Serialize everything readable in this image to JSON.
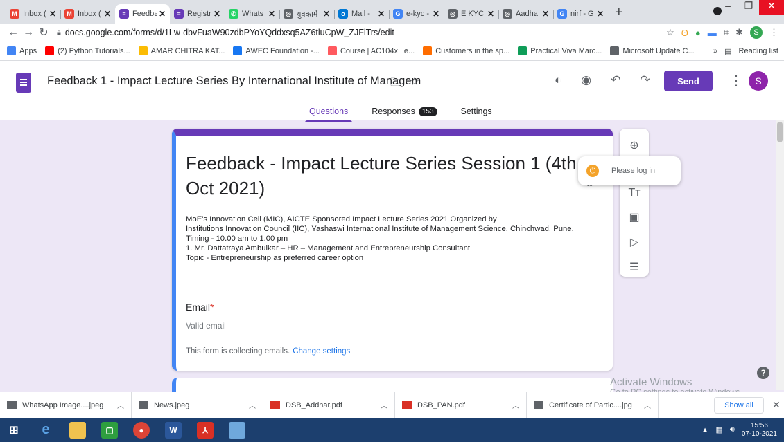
{
  "browser": {
    "tabs": [
      {
        "label": "Inbox (",
        "color": "#ea4335",
        "glyph": "M"
      },
      {
        "label": "Inbox (",
        "color": "#ea4335",
        "glyph": "M"
      },
      {
        "label": "Feedba",
        "color": "#673ab7",
        "glyph": "≡",
        "active": true
      },
      {
        "label": "Registr",
        "color": "#673ab7",
        "glyph": "≡"
      },
      {
        "label": "Whats",
        "color": "#25d366",
        "glyph": "✆"
      },
      {
        "label": "युवकार्म",
        "color": "#5f6368",
        "glyph": "◎"
      },
      {
        "label": "Mail - ",
        "color": "#0078d4",
        "glyph": "o"
      },
      {
        "label": "e-kyc -",
        "color": "#4285f4",
        "glyph": "G"
      },
      {
        "label": "E KYC (",
        "color": "#5f6368",
        "glyph": "◎"
      },
      {
        "label": "Aadha",
        "color": "#5f6368",
        "glyph": "◎"
      },
      {
        "label": "nirf - G",
        "color": "#4285f4",
        "glyph": "G"
      }
    ],
    "new_tab": "+",
    "url": "docs.google.com/forms/d/1Lw-dbvFuaW90zdbPYoYQddxsq5AZ6tluCpW_ZJFlTrs/edit",
    "profile_initial": "S",
    "bookmarks": [
      {
        "label": "Apps",
        "color": "#4285f4"
      },
      {
        "label": "(2) Python Tutorials...",
        "color": "#ff0000"
      },
      {
        "label": "AMAR CHITRA KAT...",
        "color": "#fbbc04"
      },
      {
        "label": "AWEC Foundation -...",
        "color": "#1877f2"
      },
      {
        "label": "Course | AC104x | e...",
        "color": "#ff5a5f"
      },
      {
        "label": "Customers in the sp...",
        "color": "#ff6d00"
      },
      {
        "label": "Practical Viva Marc...",
        "color": "#0f9d58"
      },
      {
        "label": "Microsoft Update C...",
        "color": "#5f6368"
      }
    ],
    "bookmarks_more": "»",
    "reading_list": "Reading list"
  },
  "form": {
    "doc_title": "Feedback 1 - Impact Lecture Series By International Institute of Managem",
    "send_label": "Send",
    "user_initial": "S",
    "tabs": {
      "questions": "Questions",
      "responses": "Responses",
      "responses_count": "153",
      "settings": "Settings"
    },
    "card": {
      "title": "Feedback - Impact Lecture Series Session 1 (4th Oct 2021)",
      "description": [
        "MoE's Innovation Cell (MIC), AICTE Sponsored Impact Lecture Series 2021 Organized by",
        "Institutions Innovation Council (IIC), Yashaswi International Institute of Management Science, Chinchwad, Pune.",
        "Timing - 10.00 am to 1.00 pm",
        "1.   Mr. Dattatraya Ambulkar – HR – Management and Entrepreneurship Consultant",
        "Topic - Entrepreneurship as preferred career option"
      ],
      "email_label": "Email",
      "required_mark": "*",
      "email_placeholder": "Valid email",
      "collecting_text": "This form is collecting emails.",
      "change_settings": "Change settings"
    },
    "popup_text": "Please log in",
    "grammarly_mark": "ω"
  },
  "overlay": {
    "activate_title": "Activate Windows",
    "activate_sub": "Go to PC settings to activate Windows."
  },
  "downloads": {
    "items": [
      {
        "name": "WhatsApp Image....jpeg",
        "color": "#5f6368"
      },
      {
        "name": "News.jpeg",
        "color": "#5f6368"
      },
      {
        "name": "DSB_Addhar.pdf",
        "color": "#d93025"
      },
      {
        "name": "DSB_PAN.pdf",
        "color": "#d93025"
      },
      {
        "name": "Certificate of Partic....jpg",
        "color": "#5f6368"
      }
    ],
    "show_all": "Show all"
  },
  "taskbar": {
    "time": "15:56",
    "date": "07-10-2021"
  }
}
